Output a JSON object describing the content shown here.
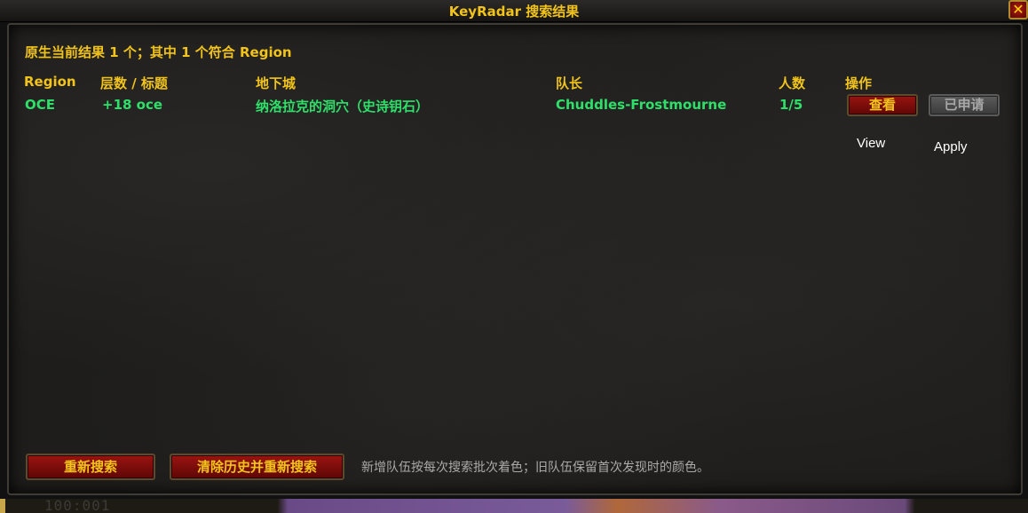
{
  "window": {
    "title": "KeyRadar 搜索结果",
    "close_glyph": "✕"
  },
  "summary": "原生当前结果 1 个；其中 1 个符合 Region",
  "table": {
    "headers": [
      "Region",
      "层数 / 标题",
      "地下城",
      "队长",
      "人数",
      "操作"
    ],
    "rows": [
      {
        "region": "OCE",
        "level_title": "+18 oce",
        "dungeon": "纳洛拉克的洞穴（史诗钥石）",
        "leader": "Chuddles-Frostmourne",
        "members": "1/5",
        "view_button": "查看",
        "apply_button": "已申请"
      }
    ]
  },
  "action_labels": {
    "view": "View",
    "apply": "Apply"
  },
  "footer": {
    "research_button": "重新搜索",
    "clear_research_button": "清除历史并重新搜索",
    "note": "新增队伍按每次搜索批次着色；旧队伍保留首次发现时的颜色。"
  },
  "background": {
    "clock": "100:001"
  },
  "colors": {
    "gold": "#f2c41b",
    "green": "#2ee06a",
    "red_button": "#9a1410",
    "disabled_gray": "#5c5c5c"
  }
}
